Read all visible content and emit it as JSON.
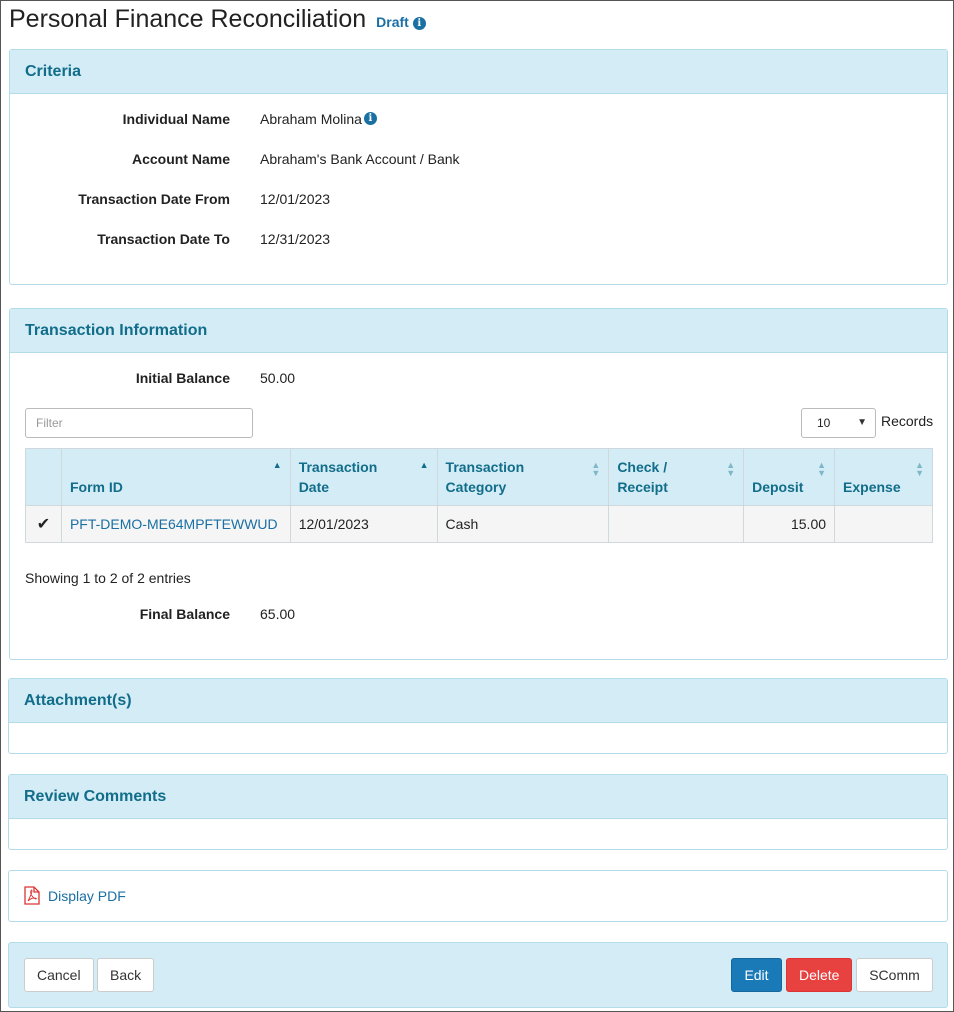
{
  "page": {
    "title": "Personal Finance Reconciliation",
    "status": "Draft"
  },
  "criteria": {
    "heading": "Criteria",
    "fields": [
      {
        "label": "Individual Name",
        "value": "Abraham Molina"
      },
      {
        "label": "Account Name",
        "value": "Abraham's Bank Account / Bank"
      },
      {
        "label": "Transaction Date From",
        "value": "12/01/2023"
      },
      {
        "label": "Transaction Date To",
        "value": "12/31/2023"
      }
    ]
  },
  "transactions": {
    "heading": "Transaction Information",
    "initial_balance_label": "Initial Balance",
    "initial_balance": "50.00",
    "filter_placeholder": "Filter",
    "records_value": "10",
    "records_label": "Records",
    "columns": [
      "Form ID",
      "Transaction Date",
      "Transaction Category",
      "Check / Receipt",
      "Deposit",
      "Expense"
    ],
    "rows": [
      {
        "form_id": "PFT-DEMO-ME64MPFTEWWUD",
        "date": "12/01/2023",
        "category": "Cash",
        "check_receipt": "",
        "deposit": "15.00",
        "expense": ""
      }
    ],
    "summary": "Showing 1 to 2 of 2 entries",
    "final_balance_label": "Final Balance",
    "final_balance": "65.00"
  },
  "attachments": {
    "heading": "Attachment(s)"
  },
  "review": {
    "heading": "Review Comments"
  },
  "pdf": {
    "label": "Display PDF"
  },
  "actions": {
    "cancel": "Cancel",
    "back": "Back",
    "edit": "Edit",
    "delete": "Delete",
    "scomm": "SComm"
  },
  "colors": {
    "panel_header": "#d3ecf5",
    "heading_text": "#116d8a",
    "link": "#1a6fa3",
    "primary": "#1a7ab8",
    "danger": "#e74240"
  },
  "icons": [
    "info-icon",
    "checkmark-icon",
    "sort-icon",
    "chevron-down-icon",
    "pdf-icon"
  ]
}
